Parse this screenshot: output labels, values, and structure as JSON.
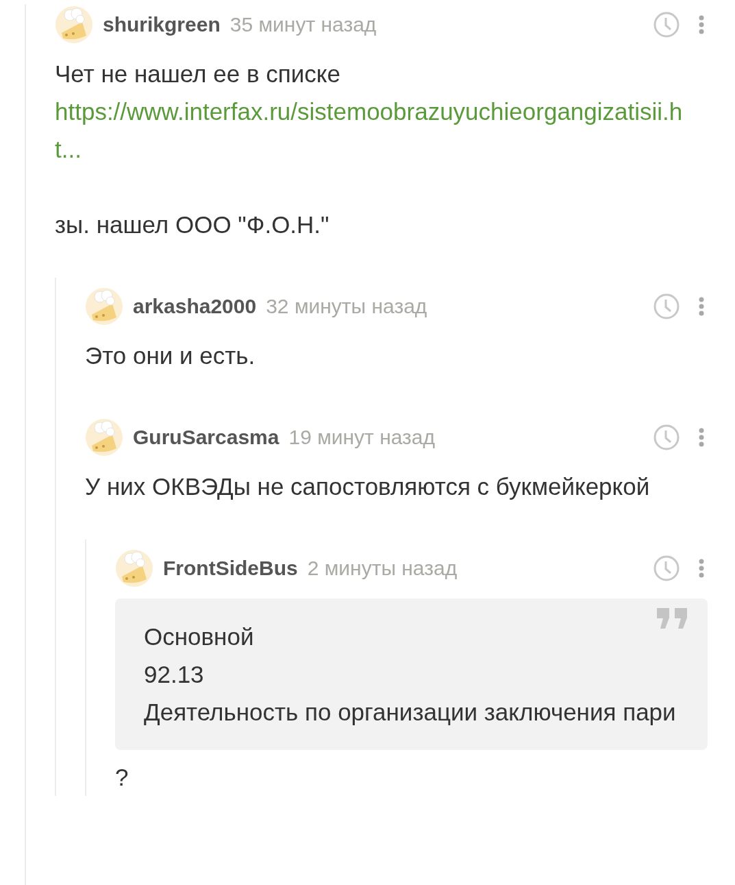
{
  "comments": [
    {
      "author": "shurikgreen",
      "time": "35 минут назад",
      "body": [
        {
          "kind": "text",
          "text": "Чет не нашел ее в списке"
        },
        {
          "kind": "link",
          "text": "https://www.interfax.ru/sistemoobrazuyuchieorgangizatisii.ht..."
        },
        {
          "kind": "gap"
        },
        {
          "kind": "text",
          "text": "зы. нашел ООО \"Ф.О.Н.\""
        }
      ],
      "children": [
        {
          "author": "arkasha2000",
          "time": "32 минуты назад",
          "body": [
            {
              "kind": "text",
              "text": "Это они и есть."
            }
          ]
        },
        {
          "author": "GuruSarcasma",
          "time": "19 минут назад",
          "body": [
            {
              "kind": "text",
              "text": "У них ОКВЭДы не сапостовляются с букмейкеркой"
            }
          ],
          "children": [
            {
              "author": "FrontSideBus",
              "time": "2 минуты назад",
              "body": [
                {
                  "kind": "quote",
                  "lines": [
                    "Основной",
                    "92.13",
                    "Деятельность по организации заключения пари"
                  ]
                },
                {
                  "kind": "text",
                  "text": "?"
                }
              ]
            }
          ]
        }
      ]
    }
  ]
}
